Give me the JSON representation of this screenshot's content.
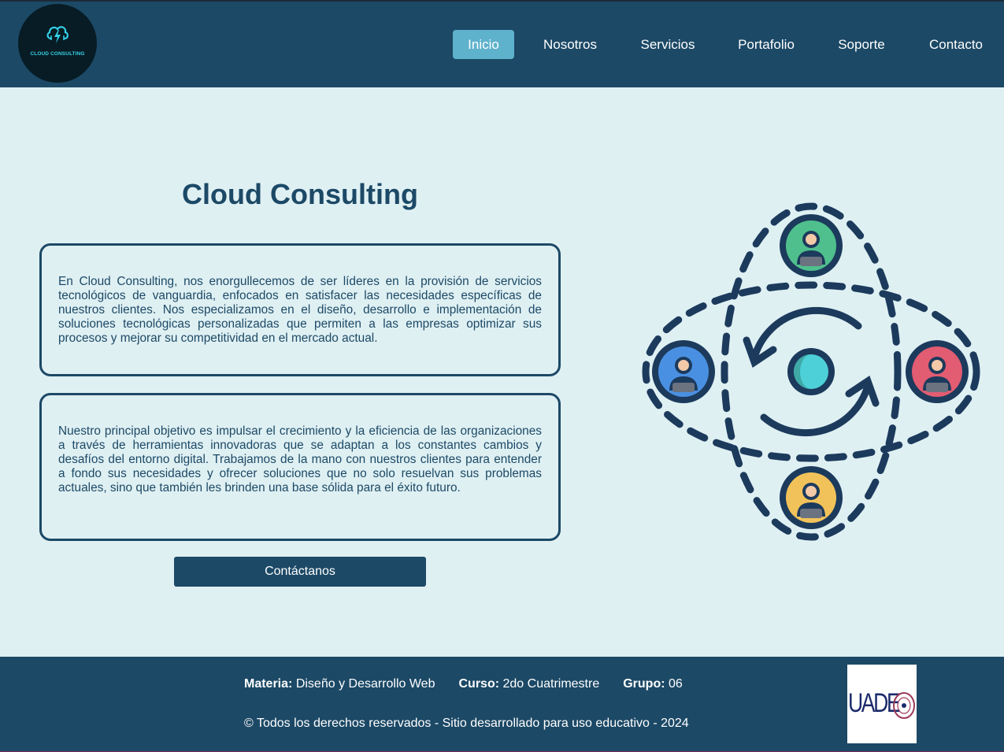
{
  "header": {
    "logo_text": "CLOUD CONSULTING",
    "nav": [
      {
        "label": "Inicio",
        "active": true
      },
      {
        "label": "Nosotros",
        "active": false
      },
      {
        "label": "Servicios",
        "active": false
      },
      {
        "label": "Portafolio",
        "active": false
      },
      {
        "label": "Soporte",
        "active": false
      },
      {
        "label": "Contacto",
        "active": false
      }
    ]
  },
  "main": {
    "title": "Cloud Consulting",
    "paragraph1": "En Cloud Consulting, nos enorgullecemos de ser líderes en la provisión de servicios tecnológicos de vanguardia, enfocados en satisfacer las necesidades específicas de nuestros clientes. Nos especializamos en el diseño, desarrollo e implementación de soluciones tecnológicas personalizadas que permiten a las empresas optimizar sus procesos y mejorar su competitividad en el mercado actual.",
    "paragraph2": "Nuestro principal objetivo es impulsar el crecimiento y la eficiencia de las organizaciones a través de herramientas innovadoras que se adaptan a los constantes cambios y desafíos del entorno digital. Trabajamos de la mano con nuestros clientes para entender a fondo sus necesidades y ofrecer soluciones que no solo resuelvan sus problemas actuales, sino que también les brinden una base sólida para el éxito futuro.",
    "cta_label": "Contáctanos",
    "illustration_icon": "network-people-icon"
  },
  "footer": {
    "materia_label": "Materia:",
    "materia_value": "Diseño y Desarrollo Web",
    "curso_label": "Curso:",
    "curso_value": "2do Cuatrimestre",
    "grupo_label": "Grupo:",
    "grupo_value": "06",
    "copyright": "© Todos los derechos reservados - Sitio desarrollado para uso educativo - 2024",
    "uade_logo_text": "UADE"
  },
  "colors": {
    "primary": "#1c4966",
    "accent": "#5fb2cc",
    "background": "#dff0f3",
    "green": "#4fc08d",
    "blue": "#4a90e2",
    "red": "#e25c72",
    "yellow": "#f2c25a",
    "cyan": "#4dd0d8"
  }
}
